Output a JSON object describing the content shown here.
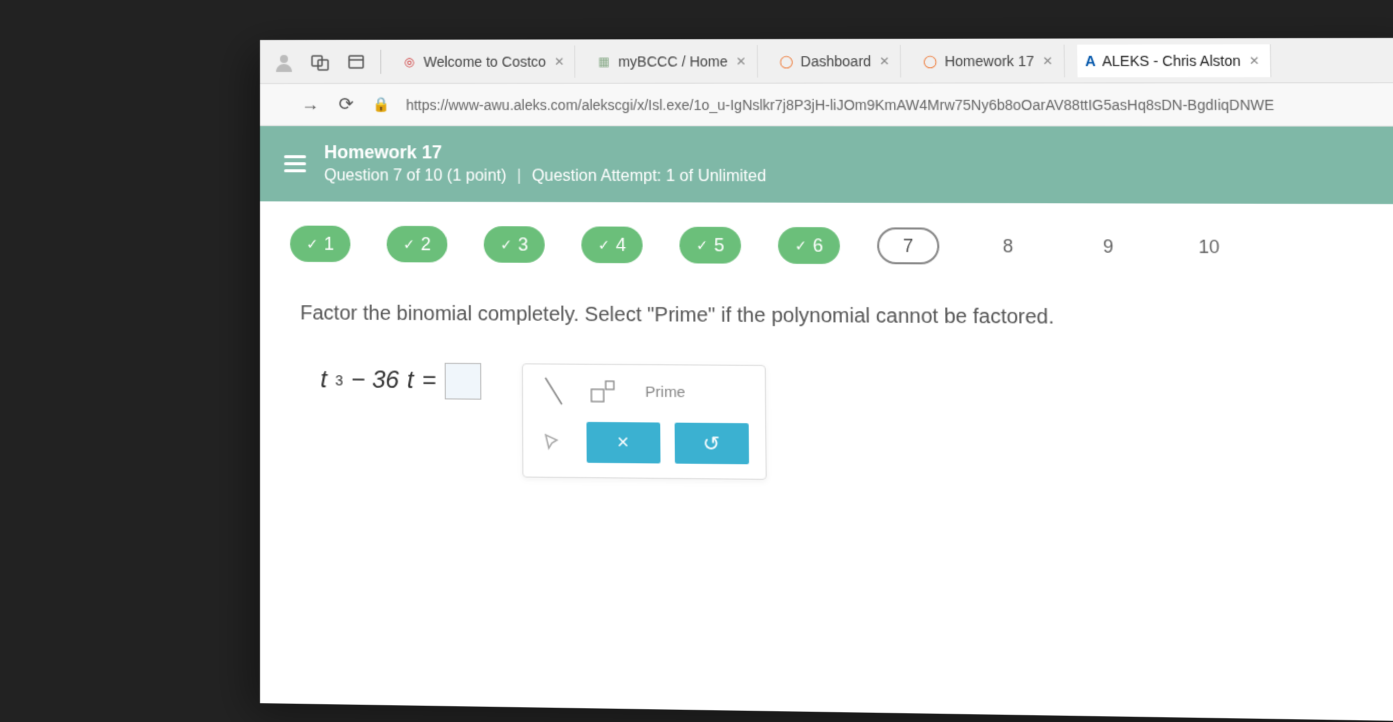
{
  "tabs": [
    {
      "label": "Welcome to Costco"
    },
    {
      "label": "myBCCC / Home"
    },
    {
      "label": "Dashboard"
    },
    {
      "label": "Homework 17"
    },
    {
      "label": "ALEKS - Chris Alston",
      "brand": "A"
    }
  ],
  "url": "https://www-awu.aleks.com/alekscgi/x/Isl.exe/1o_u-IgNslkr7j8P3jH-liJOm9KmAW4Mrw75Ny6b8oOarAV88ttIG5asHq8sDN-BgdIiqDNWE",
  "header": {
    "title": "Homework 17",
    "question_of": "Question 7 of 10 (1 point)",
    "attempt": "Question Attempt: 1 of Unlimited"
  },
  "questions": [
    {
      "n": "1",
      "state": "done"
    },
    {
      "n": "2",
      "state": "done"
    },
    {
      "n": "3",
      "state": "done"
    },
    {
      "n": "4",
      "state": "done"
    },
    {
      "n": "5",
      "state": "done"
    },
    {
      "n": "6",
      "state": "done"
    },
    {
      "n": "7",
      "state": "current"
    },
    {
      "n": "8",
      "state": "todo"
    },
    {
      "n": "9",
      "state": "todo"
    },
    {
      "n": "10",
      "state": "todo"
    }
  ],
  "prompt": "Factor the binomial completely. Select \"Prime\" if the polynomial cannot be factored.",
  "expression": {
    "var": "t",
    "exp": "3",
    "middle": " − 36",
    "var2": "t",
    "eq": " ="
  },
  "toolbox": {
    "prime_label": "Prime",
    "clear_label": "×",
    "reset_label": "↺"
  }
}
